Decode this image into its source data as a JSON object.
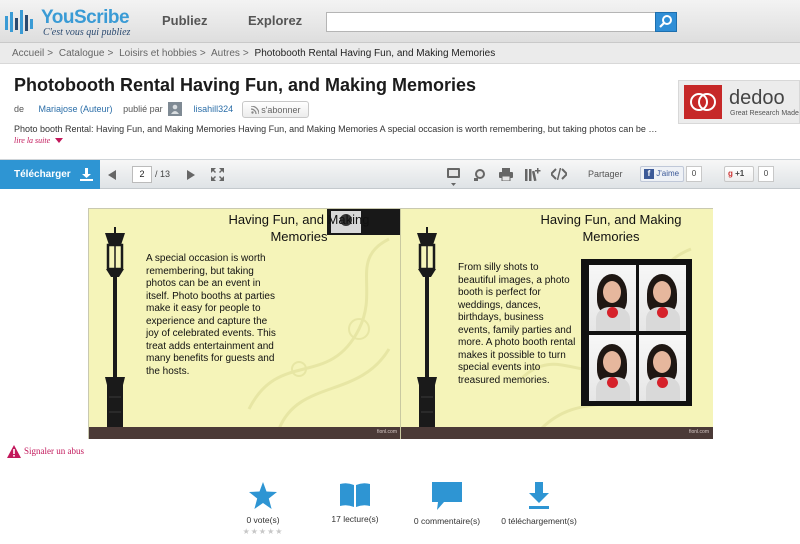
{
  "header": {
    "logo": {
      "name": "YouScribe",
      "tagline": "C'est vous qui publiez"
    },
    "nav": [
      {
        "label": "Publiez"
      },
      {
        "label": "Explorez"
      }
    ],
    "search": {
      "placeholder": ""
    }
  },
  "breadcrumb": {
    "items": [
      "Accueil",
      "Catalogue",
      "Loisirs et hobbies",
      "Autres"
    ],
    "current": "Photobooth Rental Having Fun, and Making Memories"
  },
  "document": {
    "title": "Photobooth Rental Having Fun, and Making Memories",
    "by_label": "de",
    "author": "Mariajose (Auteur)",
    "published_by_label": "publié par",
    "publisher": "lisahill324",
    "subscribe_label": "s'abonner",
    "description": "Photo booth Rental: Having Fun, and Making Memories Having Fun, and Making Memories A special occasion is worth remembering, but taking photos can be …",
    "read_more": "lire la suite"
  },
  "ad": {
    "name": "dedoo",
    "tagline": "Great Research Made"
  },
  "toolbar": {
    "download_label": "Télécharger",
    "current_page": "2",
    "total_pages": "/ 13",
    "share_label": "Partager",
    "like_label": "J'aime",
    "like_count": "0",
    "gplus_label": "+1",
    "gplus_count": "0"
  },
  "viewer": {
    "left_page": {
      "title": "Having Fun, and Making Memories",
      "body": "A special occasion is worth remembering, but taking photos can be an event in itself. Photo booths at parties make it easy for people to experience and capture the joy of celebrated events. This treat adds entertainment and many benefits for guests and the hosts.",
      "footer": "fionl.com"
    },
    "right_page": {
      "title": "Having Fun, and Making Memories",
      "body": "From silly shots to beautiful images, a photo booth is perfect for weddings, dances, birthdays, business events, family parties and more.  A photo booth rental makes it possible to turn special events into treasured memories.",
      "footer": "fionl.com"
    }
  },
  "report_label": "Signaler un abus",
  "stats": [
    {
      "label": "0 vote(s)",
      "icon": "star-icon"
    },
    {
      "label": "17 lecture(s)",
      "icon": "book-icon"
    },
    {
      "label": "0 commentaire(s)",
      "icon": "comment-icon"
    },
    {
      "label": "0 téléchargement(s)",
      "icon": "download-icon"
    }
  ],
  "colors": {
    "brand_blue": "#2e95d3",
    "link": "#2b6ea8",
    "alert": "#c2185b",
    "page_bg": "#f5f4b9"
  }
}
